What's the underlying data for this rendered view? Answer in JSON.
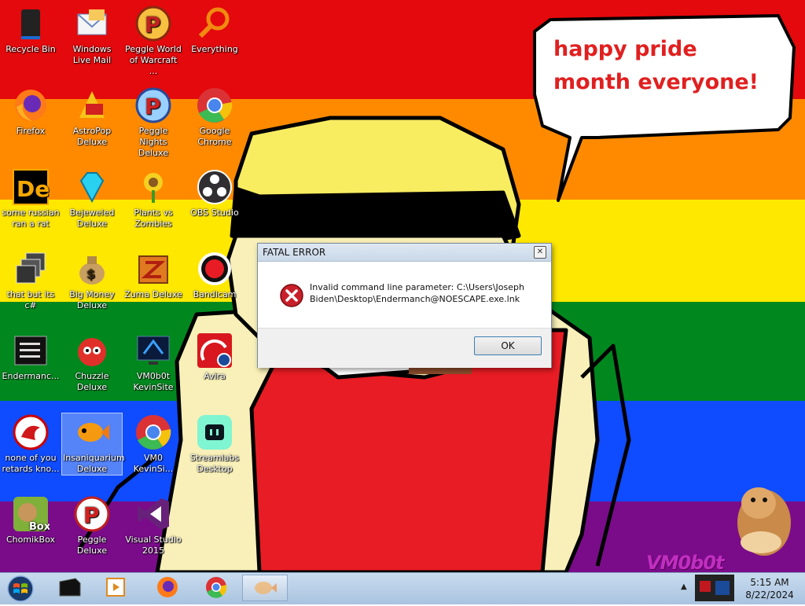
{
  "desktop": {
    "icons": [
      {
        "label": "Recycle Bin"
      },
      {
        "label": "Windows Live Mail"
      },
      {
        "label": "Peggle World of Warcraft ..."
      },
      {
        "label": "Everything"
      },
      {
        "label": "Firefox"
      },
      {
        "label": "AstroPop Deluxe"
      },
      {
        "label": "Peggle Nights Deluxe"
      },
      {
        "label": "Google Chrome"
      },
      {
        "label": "some russian ran a rat"
      },
      {
        "label": "Bejeweled Deluxe"
      },
      {
        "label": "Plants vs Zombies"
      },
      {
        "label": "OBS Studio"
      },
      {
        "label": "that but its c#"
      },
      {
        "label": "Big Money Deluxe"
      },
      {
        "label": "Zuma Deluxe"
      },
      {
        "label": "Bandicam"
      },
      {
        "label": "Endermanc..."
      },
      {
        "label": "Chuzzle Deluxe"
      },
      {
        "label": "VM0b0t KevinSite"
      },
      {
        "label": "Avira"
      },
      {
        "label": "none of you retards kno..."
      },
      {
        "label": "Insaniquarium Deluxe"
      },
      {
        "label": "VM0 KevinSi..."
      },
      {
        "label": "Streamlabs Desktop"
      },
      {
        "label": "ChomikBox"
      },
      {
        "label": "Peggle Deluxe"
      },
      {
        "label": "Visual Studio 2015"
      }
    ],
    "speech_bubble": "happy pride month everyone!",
    "watermark": "VM0b0t"
  },
  "dialog": {
    "title": "FATAL ERROR",
    "close_glyph": "✕",
    "message": "Invalid command line parameter: C:\\Users\\Joseph Biden\\Desktop\\Endermanch@NOESCAPE.exe.lnk",
    "ok_label": "OK"
  },
  "taskbar": {
    "items": [
      {
        "icon": "windows-start-icon"
      },
      {
        "icon": "terminal-icon"
      },
      {
        "icon": "media-player-icon"
      },
      {
        "icon": "firefox-icon"
      },
      {
        "icon": "chrome-icon"
      },
      {
        "icon": "insaniquarium-icon"
      }
    ],
    "show_hidden": "▲",
    "time": "5:15 AM",
    "date": "8/22/2024"
  },
  "colors": {
    "stripe_red": "#e4090c",
    "stripe_orange": "#ff8a00",
    "stripe_yellow": "#ffe800",
    "stripe_green": "#00881f",
    "stripe_blue": "#0f4bff",
    "stripe_purple": "#7a0c8a",
    "bubble_text": "#e02020",
    "character_skin": "#f8f0b8",
    "character_shirt": "#e81c24",
    "cap_yellow": "#f8ec60"
  }
}
